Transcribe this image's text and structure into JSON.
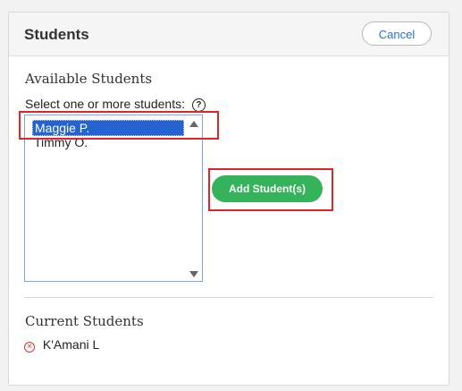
{
  "header": {
    "title": "Students",
    "cancel_label": "Cancel"
  },
  "available": {
    "title": "Available Students",
    "hint": "Select one or more students:",
    "help_icon": "?",
    "students": [
      "Maggie P.",
      "Timmy O."
    ],
    "selected": "Maggie P."
  },
  "actions": {
    "add_label": "Add Student(s)"
  },
  "current": {
    "title": "Current Students",
    "students": [
      "K'Amani L"
    ],
    "remove_icon": "×"
  },
  "colors": {
    "accent_blue": "#2563d3",
    "add_green": "#34b35a",
    "highlight_red": "#e0232c",
    "remove_red": "#dd3333"
  }
}
